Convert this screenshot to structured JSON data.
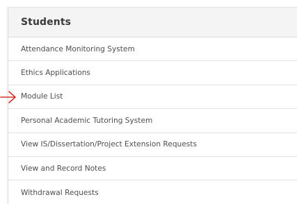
{
  "panel": {
    "title": "Students",
    "items": [
      {
        "label": "Attendance Monitoring System"
      },
      {
        "label": "Ethics Applications"
      },
      {
        "label": "Module List"
      },
      {
        "label": "Personal Academic Tutoring System"
      },
      {
        "label": "View IS/Dissertation/Project Extension Requests"
      },
      {
        "label": "View and Record Notes"
      },
      {
        "label": "Withdrawal Requests"
      }
    ]
  },
  "annotation": {
    "icon": "arrow-right-icon",
    "color": "#d9312b",
    "points_to": "Module List"
  }
}
